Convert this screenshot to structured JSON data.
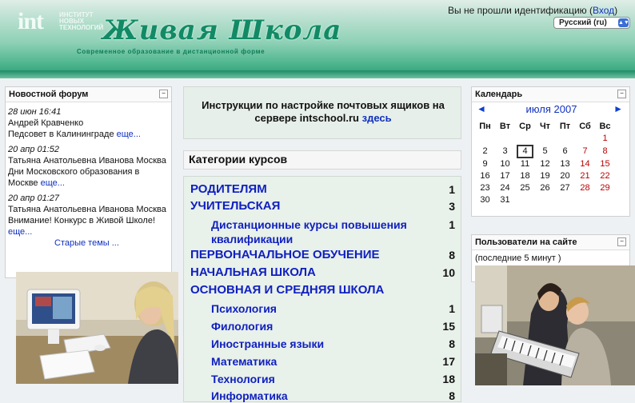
{
  "header": {
    "logo": "int",
    "institute_lines": "ИНСТИТУТ\nНОВЫХ\nТЕХНОЛОГИЙ",
    "brand": "Живая Школа",
    "tagline": "Современное образование в дистанционной форме",
    "login_text": "Вы не прошли идентификацию (",
    "login_link": "Вход",
    "login_end": ")",
    "language": "Русский (ru)"
  },
  "news": {
    "title": "Новостной форум",
    "items": [
      {
        "date": "28 июн 16:41",
        "author": "Андрей Кравченко",
        "text": "Педсовет в Калининграде",
        "more": "еще..."
      },
      {
        "date": "20 апр 01:52",
        "author": "Татьяна Анатольевна Иванова Москва",
        "text": "Дни Московского образования в Москве",
        "more": "еще..."
      },
      {
        "date": "20 апр 01:27",
        "author": "Татьяна Анатольевна Иванова Москва",
        "text": "Внимание! Конкурс в Живой Школе!",
        "more": "еще..."
      }
    ],
    "old_topics": "Старые темы ..."
  },
  "instructions": {
    "text": "Инструкции по настройке почтовых ящиков на сервере intschool.ru",
    "link": "здесь"
  },
  "categories": {
    "title": "Категории курсов",
    "items": [
      {
        "label": "РОДИТЕЛЯМ",
        "count": "1"
      },
      {
        "label": "УЧИТЕЛЬСКАЯ",
        "count": "3"
      },
      {
        "label": "Дистанционные курсы повышения квалификации",
        "count": "1"
      },
      {
        "label": "ПЕРВОНАЧАЛЬНОЕ ОБУЧЕНИЕ",
        "count": "8"
      },
      {
        "label": "НАЧАЛЬНАЯ ШКОЛА",
        "count": "10"
      },
      {
        "label": "ОСНОВНАЯ И СРЕДНЯЯ ШКОЛА",
        "count": ""
      },
      {
        "label": "Психология",
        "count": "1"
      },
      {
        "label": "Филология",
        "count": "15"
      },
      {
        "label": "Иностранные языки",
        "count": "8"
      },
      {
        "label": "Математика",
        "count": "17"
      },
      {
        "label": "Технология",
        "count": "18"
      },
      {
        "label": "Информатика",
        "count": "8"
      }
    ]
  },
  "calendar": {
    "title": "Календарь",
    "prev": "◄",
    "month": "июля 2007",
    "next": "►",
    "weekdays": [
      "Пн",
      "Вт",
      "Ср",
      "Чт",
      "Пт",
      "Сб",
      "Вс"
    ],
    "weeks": [
      [
        "",
        "",
        "",
        "",
        "",
        "",
        "1"
      ],
      [
        "2",
        "3",
        "4",
        "5",
        "6",
        "7",
        "8"
      ],
      [
        "9",
        "10",
        "11",
        "12",
        "13",
        "14",
        "15"
      ],
      [
        "16",
        "17",
        "18",
        "19",
        "20",
        "21",
        "22"
      ],
      [
        "23",
        "24",
        "25",
        "26",
        "27",
        "28",
        "29"
      ],
      [
        "30",
        "31",
        "",
        "",
        "",
        "",
        ""
      ]
    ],
    "today": "4"
  },
  "users": {
    "title": "Пользователи на сайте",
    "subtitle": "(последние 5 минут )"
  },
  "minimize": "−"
}
